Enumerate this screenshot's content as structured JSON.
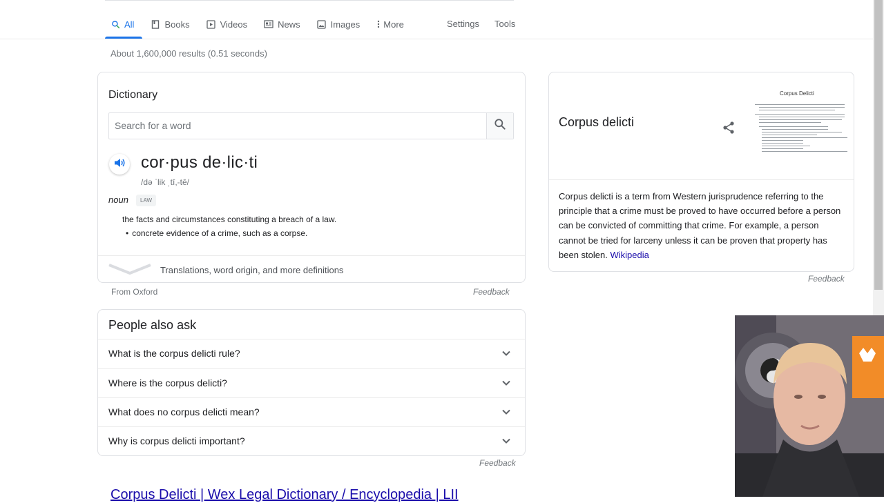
{
  "tabs": [
    {
      "label": "All",
      "icon": "search-icon",
      "active": true
    },
    {
      "label": "Books",
      "icon": "book-icon"
    },
    {
      "label": "Videos",
      "icon": "video-icon"
    },
    {
      "label": "News",
      "icon": "news-icon"
    },
    {
      "label": "Images",
      "icon": "image-icon"
    },
    {
      "label": "More",
      "icon": "more-vert-icon"
    }
  ],
  "tools": {
    "settings": "Settings",
    "tools": "Tools"
  },
  "result_stats": "About 1,600,000 results (0.51 seconds)",
  "dictionary": {
    "title": "Dictionary",
    "search_placeholder": "Search for a word",
    "word": "cor·pus de·lic·ti",
    "phonetic": "/də ˈlik ˌtī,-tē/",
    "part_of_speech": "noun",
    "label": "LAW",
    "definition": "the facts and circumstances constituting a breach of a law.",
    "sub_definition": "concrete evidence of a crime, such as a corpse.",
    "more": "Translations, word origin, and more definitions",
    "from": "From Oxford",
    "feedback": "Feedback"
  },
  "people_also_ask": {
    "title": "People also ask",
    "questions": [
      "What is the corpus delicti rule?",
      "Where is the corpus delicti?",
      "What does no corpus delicti mean?",
      "Why is corpus delicti important?"
    ],
    "feedback": "Feedback"
  },
  "knowledge_panel": {
    "title": "Corpus delicti",
    "thumbnail_title": "Corpus Delicti",
    "description": "Corpus delicti is a term from Western jurisprudence referring to the principle that a crime must be proved to have occurred before a person can be convicted of committing that crime. For example, a person cannot be tried for larceny unless it can be proven that property has been stolen.",
    "source": "Wikipedia",
    "feedback": "Feedback"
  },
  "first_result": {
    "title": "Corpus Delicti | Wex Legal Dictionary / Encyclopedia | LII"
  },
  "colors": {
    "accent": "#1a73e8",
    "link": "#1a0dab",
    "text": "#202124",
    "muted": "#70757a"
  }
}
